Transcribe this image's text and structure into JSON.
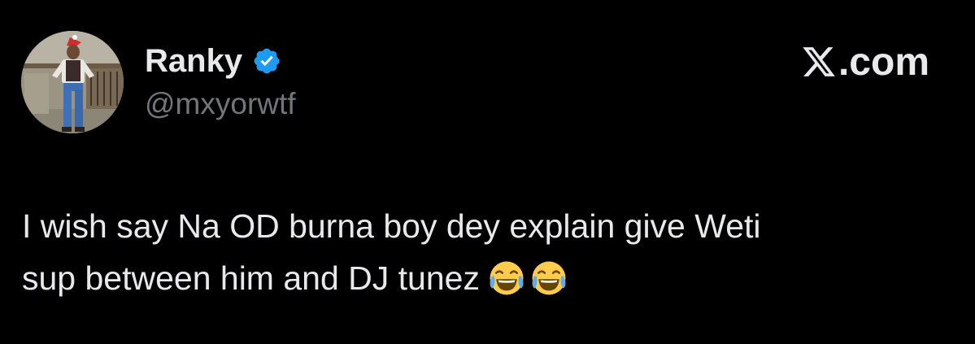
{
  "author": {
    "display_name": "Ranky",
    "handle": "@mxyorwtf",
    "verified_icon": "verified-badge-icon",
    "verified_color": "#1d9bf0",
    "avatar": "avatar-photo"
  },
  "brand": {
    "text": ".com",
    "logo_icon": "x-logo-icon"
  },
  "tweet": {
    "line1": "I wish say Na OD burna boy dey explain give Weti",
    "line2": "sup between him and DJ tunez",
    "emojis": [
      "tears-of-joy-emoji",
      "tears-of-joy-emoji"
    ]
  },
  "colors": {
    "background": "#000000",
    "text_primary": "#e7e9ea",
    "text_secondary": "#71767b"
  }
}
